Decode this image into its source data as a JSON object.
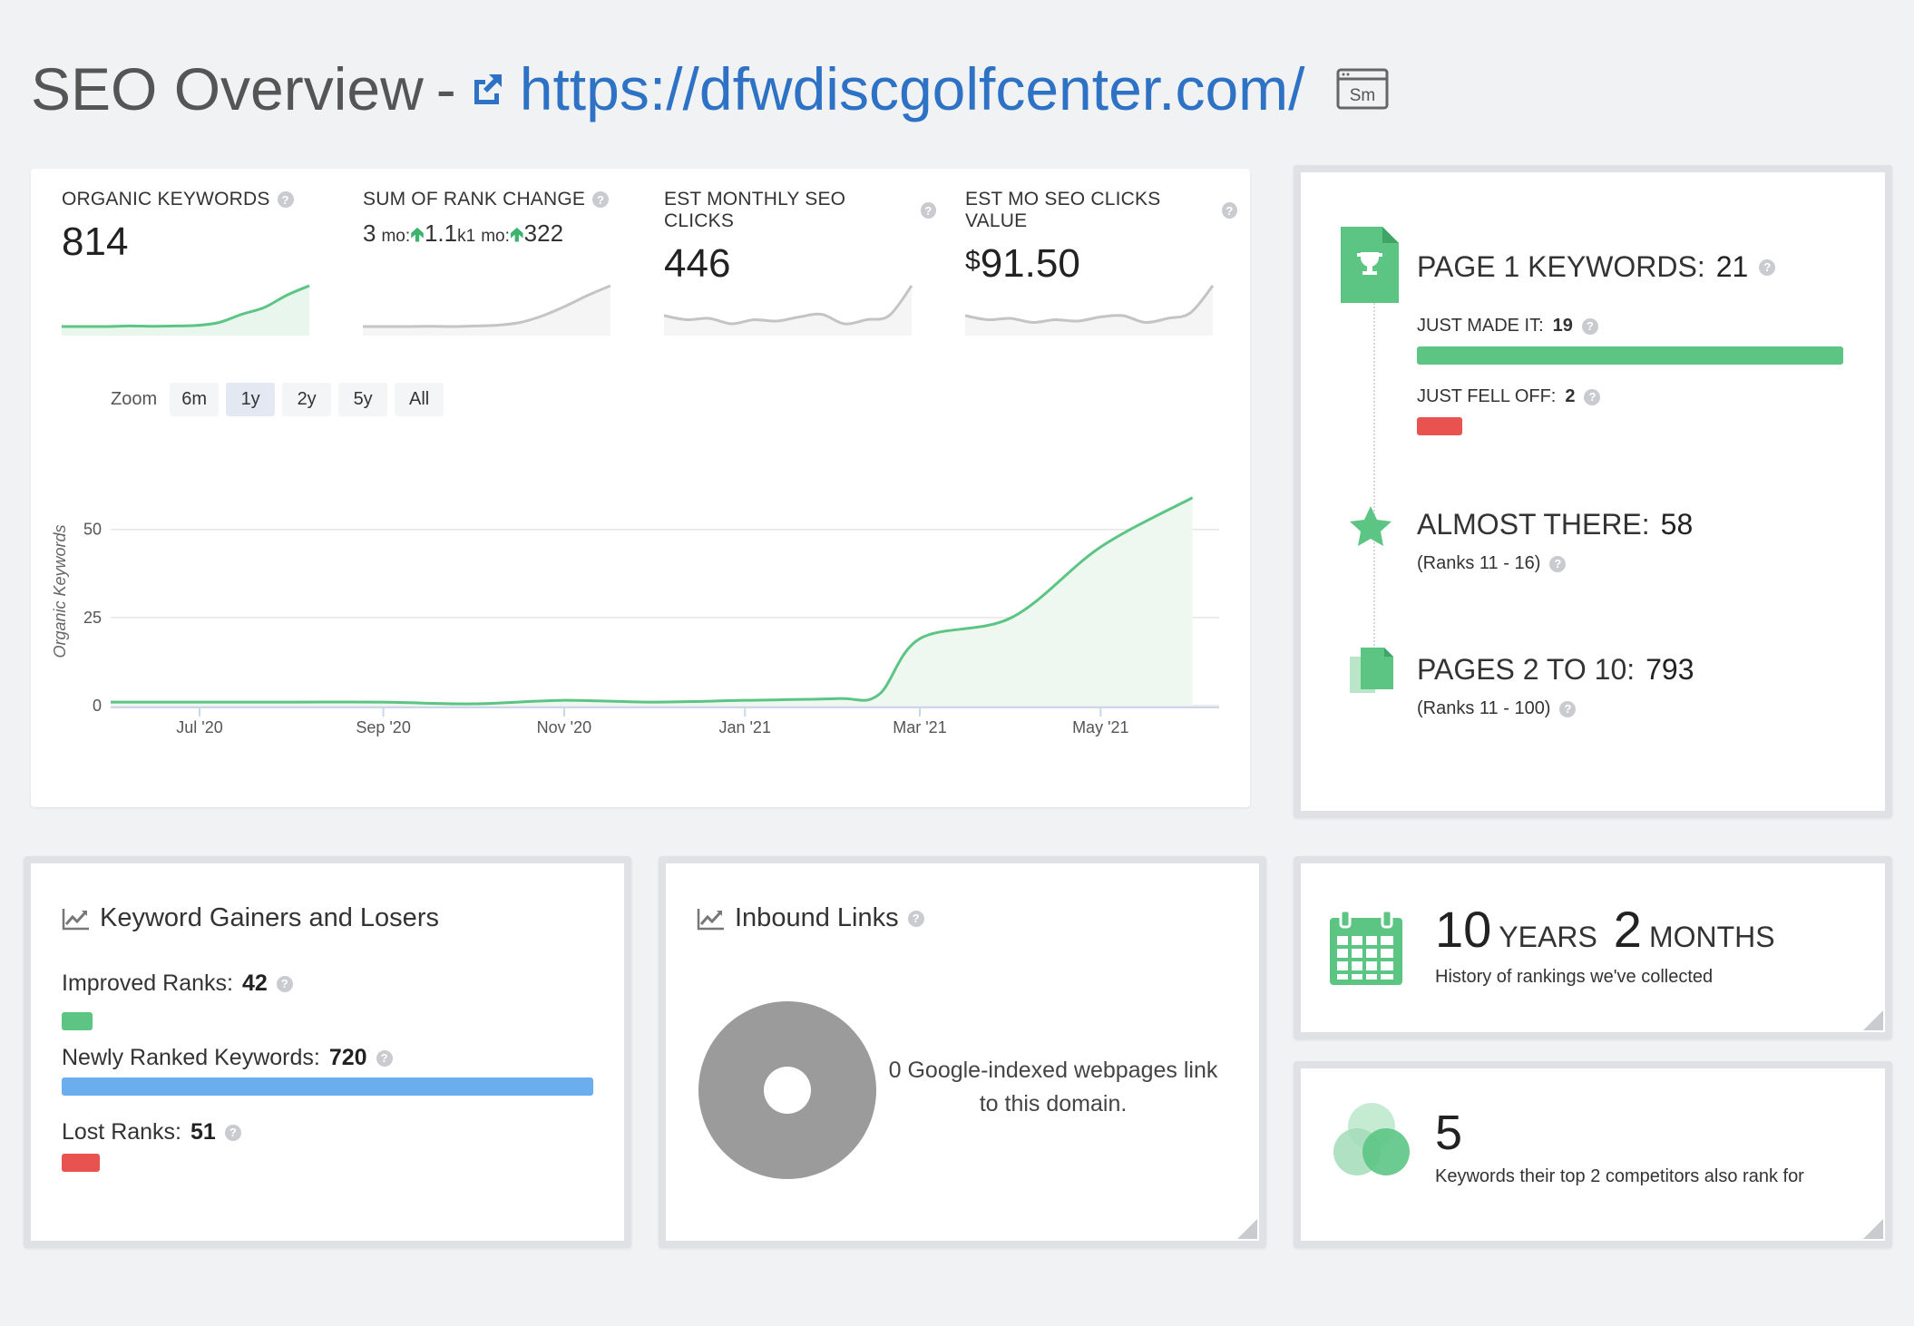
{
  "header": {
    "title": "SEO Overview",
    "separator": "-",
    "url": "https://dfwdiscgolfcenter.com/",
    "badge": "Sm"
  },
  "kpis": {
    "organic_keywords": {
      "label": "ORGANIC KEYWORDS",
      "value": "814"
    },
    "rank_change": {
      "label": "SUM OF RANK CHANGE",
      "p1": "3",
      "p1_unit": "mo:",
      "p1_value": "1.1",
      "p2": "k1",
      "p2_unit": "mo:",
      "p2_value": "322"
    },
    "monthly_clicks": {
      "label": "EST MONTHLY SEO CLICKS",
      "value": "446"
    },
    "clicks_value": {
      "label": "EST MO SEO CLICKS VALUE",
      "currency": "$",
      "value": "91.50"
    }
  },
  "sparklines": {
    "organic_keywords": [
      2,
      2,
      2,
      2.2,
      2.1,
      2.2,
      2.4,
      3.5,
      6.5,
      9,
      13.5,
      17
    ],
    "rank_change": [
      2,
      2,
      2,
      2.1,
      2,
      2.2,
      2.5,
      3.5,
      6,
      9.5,
      13.5,
      17
    ],
    "monthly_clicks": [
      6,
      4.5,
      5,
      3,
      4.5,
      4,
      5.5,
      6.5,
      3,
      4.5,
      6,
      17
    ],
    "clicks_value": [
      6,
      4.5,
      5,
      3.5,
      4.5,
      4,
      5.5,
      6,
      3.5,
      5,
      7,
      17
    ]
  },
  "zoom": {
    "label": "Zoom",
    "options": [
      "6m",
      "1y",
      "2y",
      "5y",
      "All"
    ],
    "active": "1y"
  },
  "chart_data": {
    "type": "area",
    "ylabel": "Organic Keywords",
    "yticks": [
      0,
      25,
      50
    ],
    "ylim": [
      0,
      70
    ],
    "xticks": [
      "Jul '20",
      "Sep '20",
      "Nov '20",
      "Jan '21",
      "Mar '21",
      "May '21"
    ],
    "x": [
      "2020-06",
      "2020-07",
      "2020-08",
      "2020-09",
      "2020-10",
      "2020-11",
      "2020-12",
      "2021-01",
      "2021-02",
      "2021-02-15",
      "2021-03",
      "2021-04",
      "2021-05",
      "2021-06"
    ],
    "values": [
      1,
      1,
      1,
      1,
      0.5,
      1.5,
      1,
      1.5,
      2,
      3,
      19,
      25,
      45,
      59
    ],
    "grid": true,
    "color": "#5cc584"
  },
  "page1": {
    "title": "PAGE 1 KEYWORDS:",
    "value": "21",
    "just_made_it": {
      "label": "JUST MADE IT:",
      "value": "19",
      "fraction": 1.0
    },
    "just_fell_off": {
      "label": "JUST FELL OFF:",
      "value": "2",
      "fraction": 0.105
    },
    "almost_there": {
      "label": "ALMOST THERE:",
      "value": "58",
      "sub": "(Ranks 11 - 16)"
    },
    "pages_2_10": {
      "label": "PAGES 2 TO 10:",
      "value": "793",
      "sub": "(Ranks 11 - 100)"
    }
  },
  "gainers": {
    "title": "Keyword Gainers and Losers",
    "improved": {
      "label": "Improved Ranks:",
      "value": "42",
      "fraction": 0.058
    },
    "newly": {
      "label": "Newly Ranked Keywords:",
      "value": "720",
      "fraction": 1.0
    },
    "lost": {
      "label": "Lost Ranks:",
      "value": "51",
      "fraction": 0.071
    }
  },
  "links": {
    "title": "Inbound Links",
    "text": "0 Google-indexed webpages link to this domain."
  },
  "history": {
    "years": "10",
    "years_label": "YEARS",
    "months": "2",
    "months_label": "MONTHS",
    "desc": "History of rankings we've collected"
  },
  "competitors": {
    "value": "5",
    "desc": "Keywords their top 2 competitors also rank for"
  },
  "colors": {
    "green": "#5cc584",
    "red": "#e8524f",
    "blue": "#6aaeee",
    "link": "#2d72c4"
  }
}
